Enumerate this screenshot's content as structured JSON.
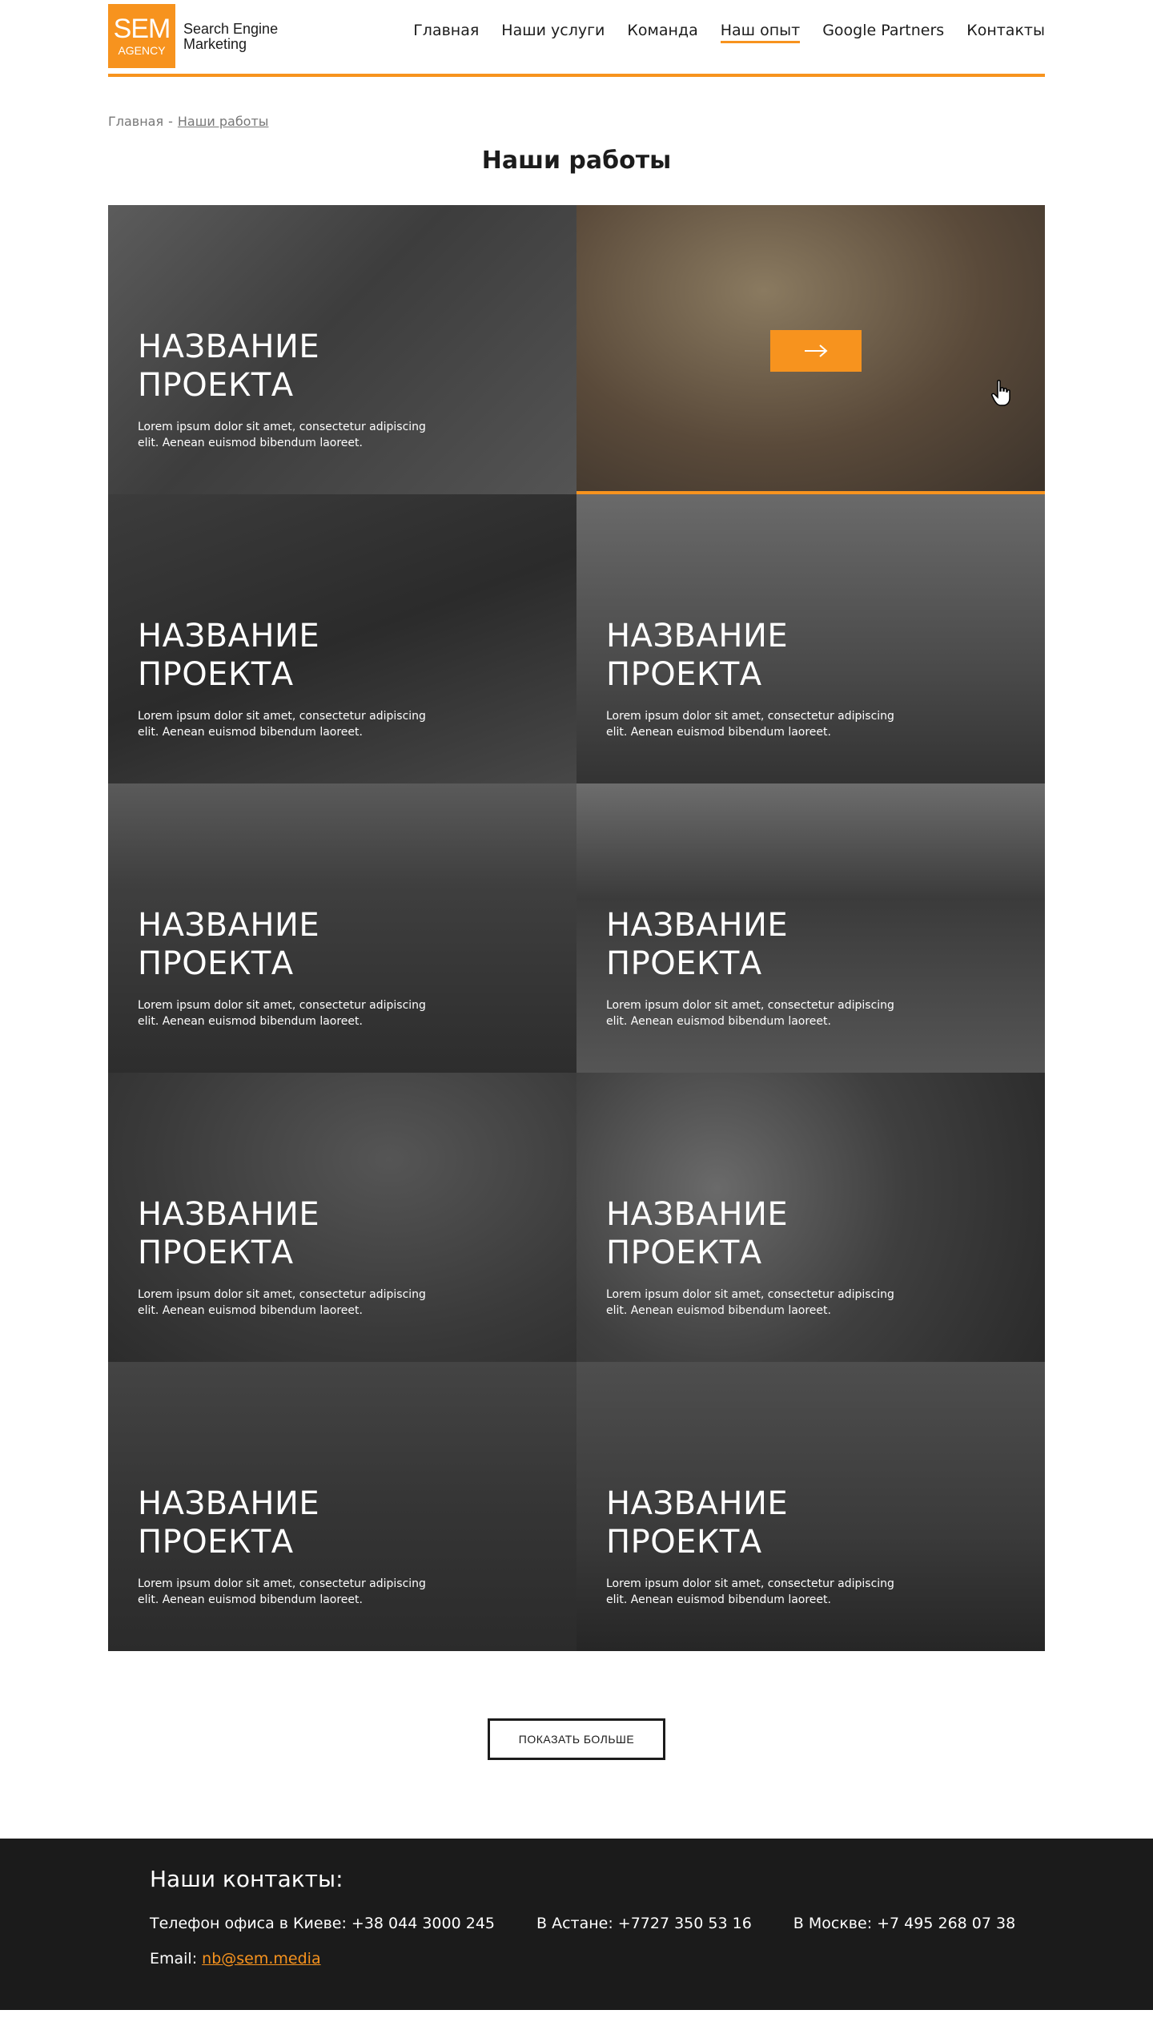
{
  "header": {
    "logo_big": "SEM",
    "logo_small": "AGENCY",
    "logo_line1": "Search Engine",
    "logo_line2": "Marketing",
    "nav": [
      {
        "label": "Главная"
      },
      {
        "label": "Наши услуги"
      },
      {
        "label": "Команда"
      },
      {
        "label": "Наш опыт"
      },
      {
        "label": "Google Partners"
      },
      {
        "label": "Контакты"
      }
    ],
    "active_nav": "Наш опыт"
  },
  "breadcrumb": {
    "home": "Главная",
    "separator": "-",
    "current": "Наши работы"
  },
  "page_title": "Наши работы",
  "projects": [
    {
      "title_line1": "НАЗВАНИЕ",
      "title_line2": "ПРОЕКТА",
      "desc": "Lorem ipsum dolor sit amet, consectetur adipiscing elit. Aenean euismod bibendum laoreet."
    },
    {
      "hovered": true,
      "arrow_icon": "arrow-right-icon",
      "cursor_icon": "hand-pointer-icon"
    },
    {
      "title_line1": "НАЗВАНИЕ",
      "title_line2": "ПРОЕКТА",
      "desc": "Lorem ipsum dolor sit amet, consectetur adipiscing elit. Aenean euismod bibendum laoreet."
    },
    {
      "title_line1": "НАЗВАНИЕ",
      "title_line2": "ПРОЕКТА",
      "desc": "Lorem ipsum dolor sit amet, consectetur adipiscing elit. Aenean euismod bibendum laoreet."
    },
    {
      "title_line1": "НАЗВАНИЕ",
      "title_line2": "ПРОЕКТА",
      "desc": "Lorem ipsum dolor sit amet, consectetur adipiscing elit. Aenean euismod bibendum laoreet."
    },
    {
      "title_line1": "НАЗВАНИЕ",
      "title_line2": "ПРОЕКТА",
      "desc": "Lorem ipsum dolor sit amet, consectetur adipiscing elit. Aenean euismod bibendum laoreet."
    },
    {
      "title_line1": "НАЗВАНИЕ",
      "title_line2": "ПРОЕКТА",
      "desc": "Lorem ipsum dolor sit amet, consectetur adipiscing elit. Aenean euismod bibendum laoreet."
    },
    {
      "title_line1": "НАЗВАНИЕ",
      "title_line2": "ПРОЕКТА",
      "desc": "Lorem ipsum dolor sit amet, consectetur adipiscing elit. Aenean euismod bibendum laoreet."
    },
    {
      "title_line1": "НАЗВАНИЕ",
      "title_line2": "ПРОЕКТА",
      "desc": "Lorem ipsum dolor sit amet, consectetur adipiscing elit. Aenean euismod bibendum laoreet."
    },
    {
      "title_line1": "НАЗВАНИЕ",
      "title_line2": "ПРОЕКТА",
      "desc": "Lorem ipsum dolor sit amet, consectetur adipiscing elit. Aenean euismod bibendum laoreet."
    }
  ],
  "show_more_label": "ПОКАЗАТЬ БОЛЬШЕ",
  "footer": {
    "title": "Наши контакты:",
    "kiev": "Телефон офиса в Киеве: +38 044 3000 245",
    "astana": "В Астане: +7727 350 53 16",
    "moscow": "В Москве: +7 495 268 07 38",
    "email_label": "Email:",
    "email": "nb@sem.media"
  },
  "colors": {
    "accent": "#f7931e",
    "footer_bg": "#1b1b1b",
    "text": "#1c1c1c"
  }
}
